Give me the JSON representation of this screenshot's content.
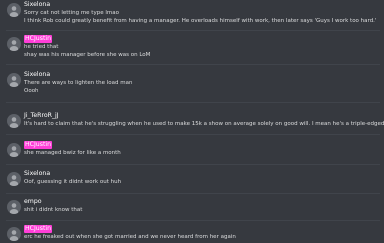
{
  "messages": [
    {
      "author": "Sixelona",
      "highlighted": false,
      "timestamp": "",
      "lines": [
        "Sorry cat not letting me type lmao",
        "I think Rob could greatly benefit from having a manager. He overloads himself with work, then later says 'Guys I work too hard.'"
      ]
    },
    {
      "author": "HCJustin",
      "highlighted": true,
      "timestamp": "",
      "lines": [
        "he tried that",
        "shay was his manager before she was on LoM"
      ]
    },
    {
      "author": "Sixelona",
      "highlighted": false,
      "timestamp": "",
      "lines": [
        "There are ways to lighten the load man",
        "Oooh"
      ]
    },
    {
      "author": "Ji_TeRroR_jJ",
      "highlighted": false,
      "timestamp": "",
      "lines": [
        "It's hard to claim that he's struggling when he used to make 15k a show on average solely on good will. I mean he's a triple-edged sword"
      ]
    },
    {
      "author": "HCJustin",
      "highlighted": true,
      "timestamp": "",
      "lines": [
        "she managed bwiz for like a month"
      ]
    },
    {
      "author": "Sixelona",
      "highlighted": false,
      "timestamp": "",
      "lines": [
        "Oof, guessing it didnt work out huh"
      ]
    },
    {
      "author": "empo",
      "highlighted": false,
      "timestamp": "",
      "lines": [
        "shit i didnt know that"
      ]
    },
    {
      "author": "HCJustin",
      "highlighted": true,
      "timestamp": "",
      "lines": [
        "erc he freaked out when she got married and we never heard from her again"
      ]
    }
  ],
  "colors": {
    "background": "#36393f",
    "text": "#dcddde",
    "username": "#ffffff",
    "highlight": "#ff3fd8",
    "timestamp": "#5e6168",
    "divider": "#40444b",
    "avatar": "#5c6067"
  },
  "icons": {
    "avatar": "default-user-avatar-icon"
  }
}
